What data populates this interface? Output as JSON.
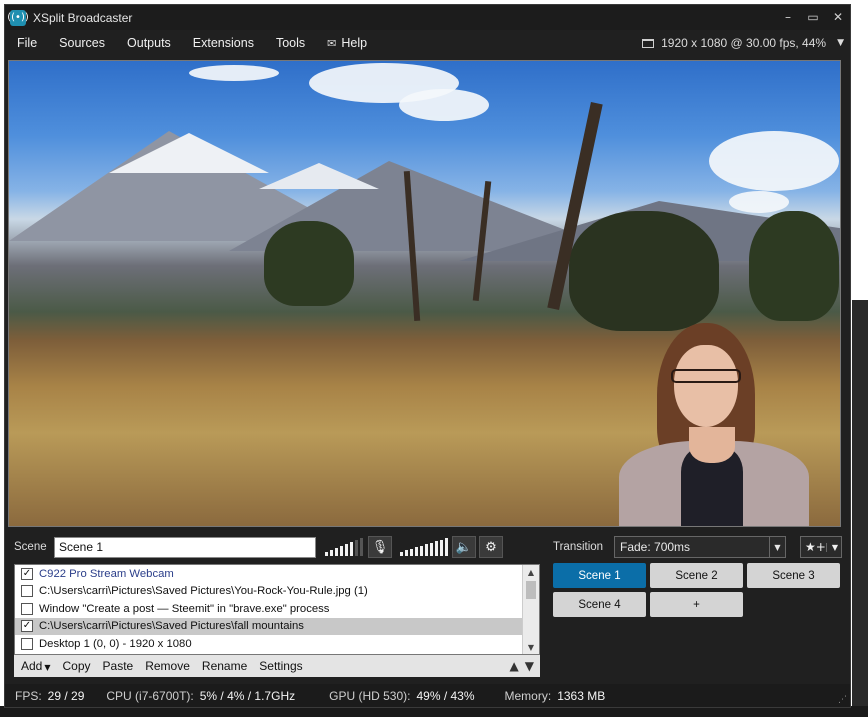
{
  "window": {
    "title": "XSplit Broadcaster",
    "icon": "xsplit-broadcast-icon"
  },
  "window_controls": {
    "minimize": "–",
    "maximize": "▭",
    "close": "✕"
  },
  "menu": {
    "items": [
      "File",
      "Sources",
      "Outputs",
      "Extensions",
      "Tools"
    ],
    "help": "Help",
    "help_icon": "mail-icon"
  },
  "resolution": {
    "label": "1920 x 1080 @ 30.00 fps, 44%",
    "icon": "monitor-icon"
  },
  "scene": {
    "label": "Scene",
    "value": "Scene 1"
  },
  "transition": {
    "label": "Transition",
    "value": "Fade: 700ms",
    "fav_icon": "★+"
  },
  "sources": [
    {
      "label": "C922 Pro Stream Webcam",
      "checked": "✓",
      "state": "active"
    },
    {
      "label": "C:\\Users\\carri\\Pictures\\Saved Pictures\\You-Rock-You-Rule.jpg (1)",
      "checked": "",
      "state": ""
    },
    {
      "label": "Window \"Create a post — Steemit\" in \"brave.exe\" process",
      "checked": "",
      "state": ""
    },
    {
      "label": "C:\\Users\\carri\\Pictures\\Saved Pictures\\fall mountains",
      "checked": "✓",
      "state": "selected"
    },
    {
      "label": "Desktop 1 (0, 0) - 1920 x 1080",
      "checked": "",
      "state": ""
    }
  ],
  "source_toolbar": {
    "add": "Add",
    "copy": "Copy",
    "paste": "Paste",
    "remove": "Remove",
    "rename": "Rename",
    "settings": "Settings"
  },
  "scenes": [
    "Scene 1",
    "Scene 2",
    "Scene 3",
    "Scene 4",
    "+"
  ],
  "active_scene": "Scene 1",
  "status": {
    "fps_label": "FPS:",
    "fps_value": "29 / 29",
    "cpu_label": "CPU (i7-6700T):",
    "cpu_value": "5% / 4% / 1.7GHz",
    "gpu_label": "GPU (HD 530):",
    "gpu_value": "49% / 43%",
    "memory_label": "Memory:",
    "memory_value": "1363 MB"
  },
  "colors": {
    "accent": "#0b6ea8",
    "background": "#202020",
    "source_text_active": "#2b3e8a"
  }
}
